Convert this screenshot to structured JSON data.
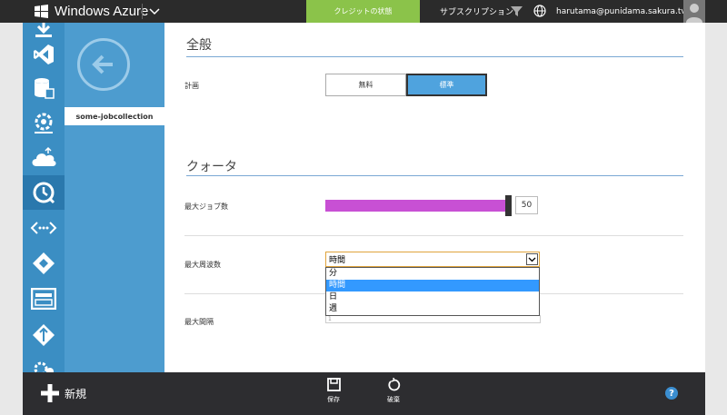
{
  "topbar": {
    "brand": "Windows Azure",
    "credit_status": "クレジットの状態",
    "subscriptions": "サブスクリプション",
    "user_email": "harutama@punidama.sakura.tv"
  },
  "subnav": {
    "collection_name": "some-jobcollection"
  },
  "general": {
    "title": "全般",
    "plan_label": "計画",
    "plan_options": [
      "無料",
      "標準"
    ],
    "plan_selected": "標準"
  },
  "quota": {
    "title": "クォータ",
    "max_jobs_label": "最大ジョブ数",
    "max_jobs_value": "50",
    "max_jobs_fraction": 1.0,
    "max_frequency_label": "最大周波数",
    "frequency_selected": "時間",
    "frequency_options": [
      "分",
      "時間",
      "日",
      "週"
    ],
    "max_interval_label": "最大間隔",
    "max_interval_value": "1"
  },
  "bottombar": {
    "new_label": "新規",
    "save_label": "保存",
    "discard_label": "破棄",
    "help_label": "?"
  },
  "colors": {
    "topbar": "#2b2b2b",
    "credit": "#8bc34a",
    "nav": "#3b8ec3",
    "slider": "#c850d4",
    "selected_plan": "#4fa3de",
    "dropdown_highlight": "#3399ff"
  }
}
